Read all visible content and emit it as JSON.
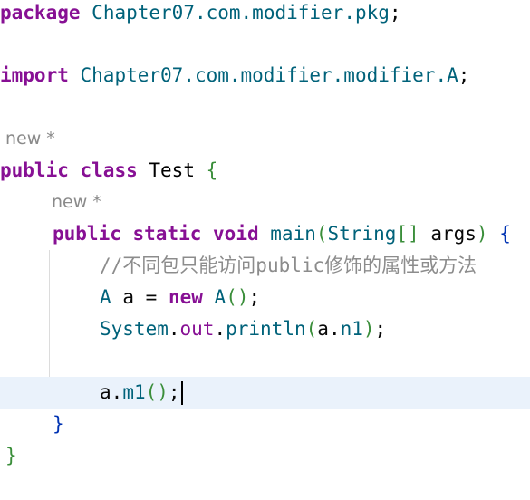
{
  "editor": {
    "line_package": {
      "keyword": "package",
      "name": "Chapter07.com.modifier.pkg",
      "semicolon": ";"
    },
    "line_import": {
      "keyword": "import",
      "name": "Chapter07.com.modifier.modifier.A",
      "semicolon": ";"
    },
    "hint_class": "new *",
    "line_class": {
      "kw_public": "public",
      "kw_class": "class",
      "name": "Test",
      "brace": "{"
    },
    "hint_method": "new *",
    "line_method": {
      "kw_public": "public",
      "kw_static": "static",
      "kw_void": "void",
      "name": "main",
      "paren_open": "(",
      "param_type": "String",
      "brackets": "[]",
      "param_name": "args",
      "paren_close": ")",
      "brace": "{"
    },
    "line_comment": {
      "slashes": "//",
      "text1": "不同包只能访问",
      "text_latin": "public",
      "text2": "修饰的属性或方法"
    },
    "line_new": {
      "type": "A",
      "var": "a",
      "eq": "=",
      "kw_new": "new",
      "ctor": "A",
      "parens": "()",
      "semicolon": ";"
    },
    "line_print": {
      "system": "System",
      "dot1": ".",
      "out": "out",
      "dot2": ".",
      "method": "println",
      "paren_open": "(",
      "obj": "a",
      "dot3": ".",
      "field": "n1",
      "paren_close": ")",
      "semicolon": ";"
    },
    "line_call": {
      "obj": "a",
      "dot": ".",
      "method": "m1",
      "parens": "()",
      "semicolon": ";"
    },
    "close_method": "}",
    "close_class": "}"
  }
}
